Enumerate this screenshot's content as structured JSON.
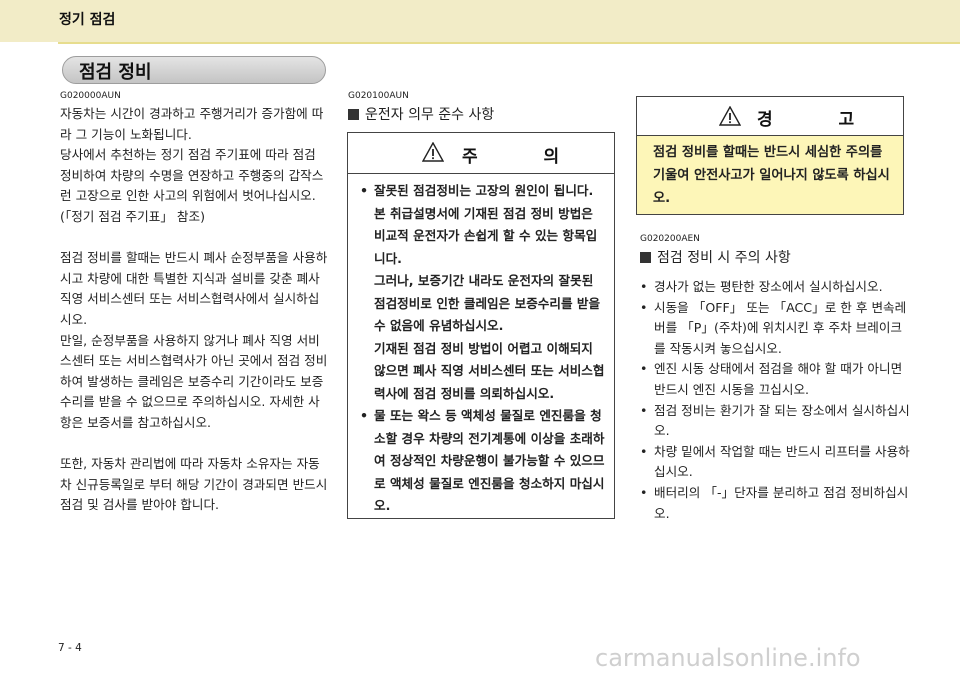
{
  "header": {
    "title": "정기 점검"
  },
  "section": {
    "title": "점검 정비"
  },
  "column1": {
    "code": "G020000AUN",
    "paragraphs": [
      "자동차는 시간이 경과하고 주행거리가 증가함에 따라 그 기능이 노화됩니다.",
      "당사에서 추천하는 정기 점검 주기표에 따라 점검 정비하여 차량의 수명을 연장하고 주행중의 갑작스런 고장으로 인한 사고의 위험에서 벗어나십시오.",
      "(「정기 점검 주기표」 참조)",
      "점검 정비를 할때는 반드시 폐사 순정부품을 사용하시고 차량에 대한 특별한 지식과 설비를 갖춘 폐사 직영 서비스센터 또는 서비스협력사에서 실시하십시오.",
      "만일, 순정부품을 사용하지 않거나 폐사 직영 서비스센터 또는 서비스협력사가 아닌 곳에서 점검 정비하여 발생하는 클레임은 보증수리 기간이라도 보증수리를 받을 수 없으므로 주의하십시오. 자세한 사항은 보증서를 참고하십시오.",
      "또한, 자동차 관리법에 따라 자동차 소유자는 자동차 신규등록일로 부터 해당 기간이 경과되면 반드시 점검 및 검사를 받아야 합니다."
    ]
  },
  "column2": {
    "code": "G020100AUN",
    "heading": "운전자 의무 준수 사항",
    "caution_title": "주 의",
    "bullets": [
      "잘못된 점검정비는 고장의 원인이 됩니다. 본 취급설명서에 기재된 점검 정비 방법은 비교적 운전자가 손쉽게 할 수 있는 항목입니다.",
      "그러나, 보증기간 내라도 운전자의 잘못된 점검정비로 인한 클레임은 보증수리를 받을 수 없음에 유념하십시오.",
      "기재된 점검 정비 방법이 어렵고 이해되지 않으면 폐사 직영 서비스센터 또는 서비스협력사에 점검 정비를 의뢰하십시오.",
      "물 또는 왁스 등 액체성 물질로 엔진룸을 청소할 경우 차량의 전기계통에 이상을 초래하여 정상적인 차량운행이 불가능할 수 있으므로 액체성 물질로 엔진룸을 청소하지 마십시오."
    ]
  },
  "column3": {
    "warning_title": "경 고",
    "warning_text": "점검 정비를 할때는 반드시 세심한 주의를 기울여 안전사고가 일어나지 않도록 하십시오.",
    "code": "G020200AEN",
    "heading": "점검 정비 시 주의 사항",
    "bullets": [
      "경사가 없는 평탄한 장소에서 실시하십시오.",
      "시동을 「OFF」 또는 「ACC」로 한 후 변속레버를 「P」(주차)에 위치시킨 후 주차 브레이크를 작동시켜 놓으십시오.",
      "엔진 시동 상태에서 점검을 해야 할 때가 아니면 반드시 엔진 시동을 끄십시오.",
      "점검 정비는 환기가 잘 되는 장소에서 실시하십시오.",
      "차량 밑에서 작업할 때는 반드시 리프터를 사용하십시오.",
      "배터리의 「-」단자를 분리하고 점검 정비하십시오."
    ]
  },
  "footer": {
    "page": "7 - 4",
    "watermark": "carmanualsonline.info"
  },
  "colors": {
    "header_band": "#f2ecc7",
    "warning_fill": "#fdf6b8"
  }
}
